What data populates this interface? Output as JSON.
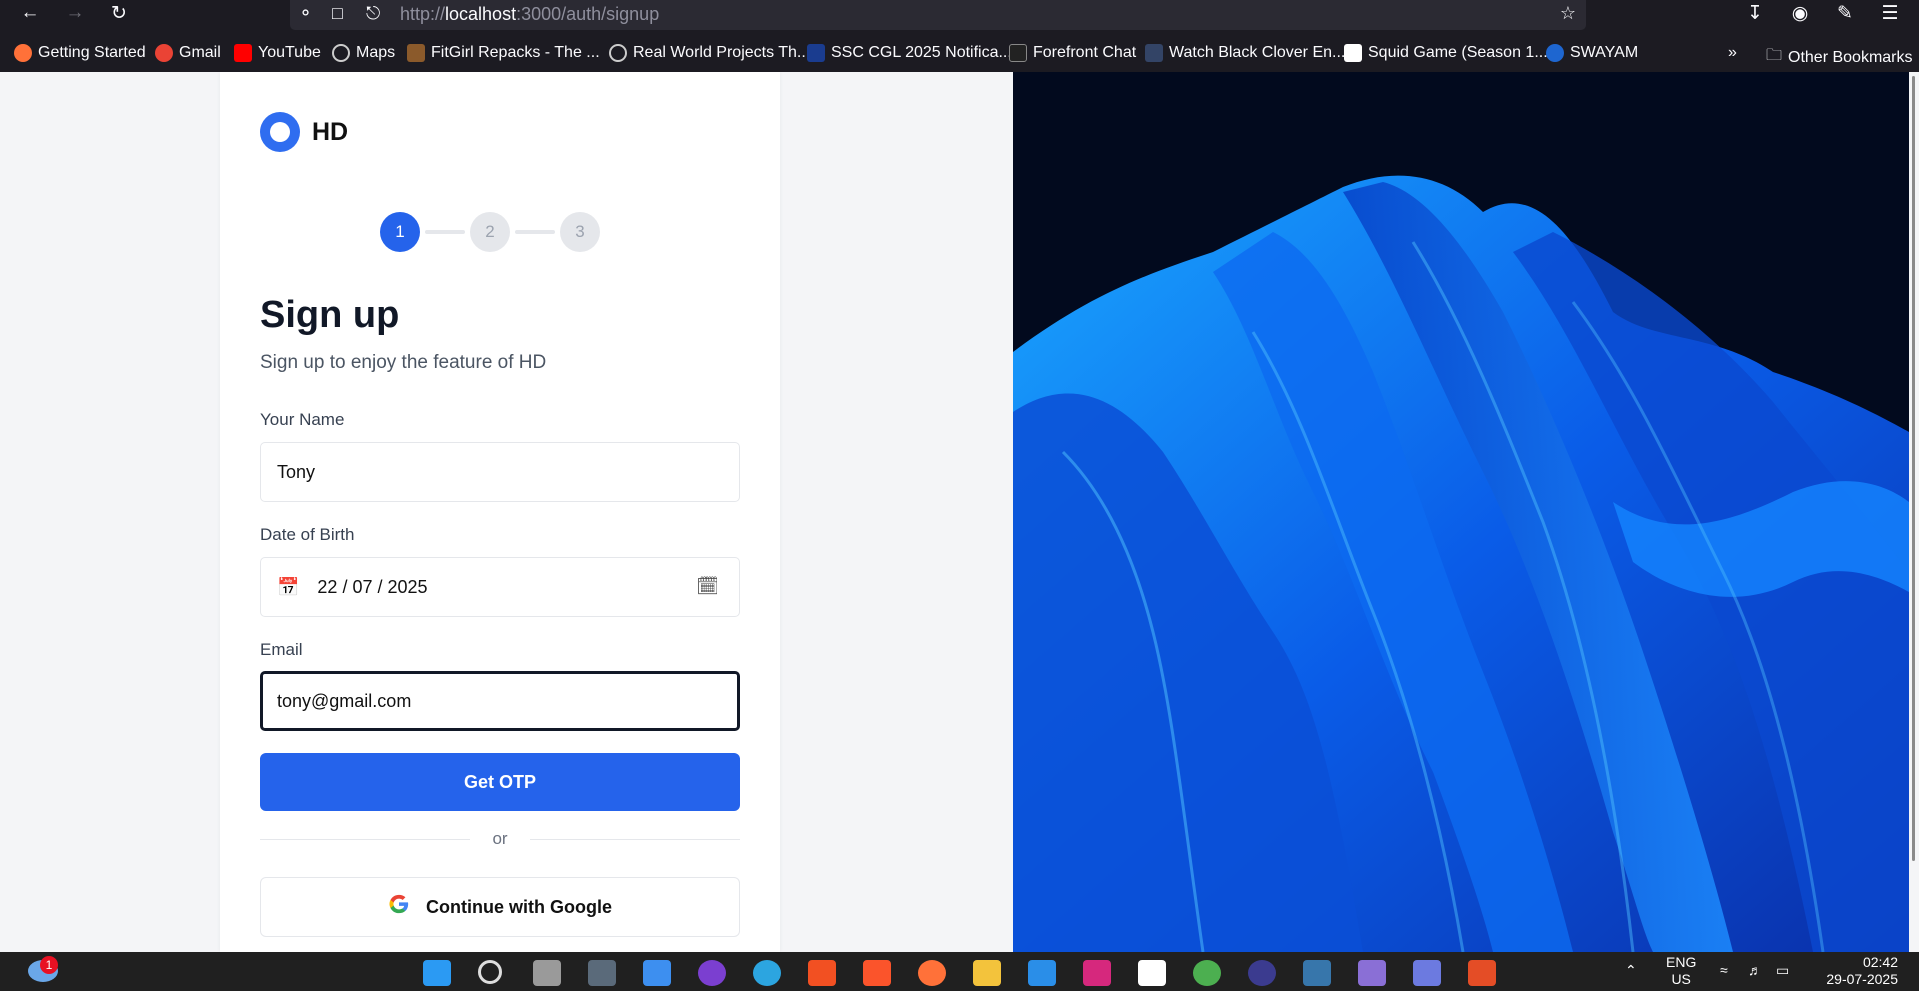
{
  "browser": {
    "url_prefix": "http://",
    "url_host": "localhost",
    "url_path": ":3000/auth/signup",
    "bookmarks": [
      {
        "label": "Getting Started",
        "color": "#ff7139"
      },
      {
        "label": "Gmail",
        "color": "#ea4335"
      },
      {
        "label": "YouTube",
        "color": "#ff0000"
      },
      {
        "label": "Maps",
        "color": "#cccccc"
      },
      {
        "label": "FitGirl Repacks - The ...",
        "color": "#8b5a2b"
      },
      {
        "label": "Real World Projects Th...",
        "color": "#cccccc"
      },
      {
        "label": "SSC CGL 2025 Notifica...",
        "color": "#1a3c8f"
      },
      {
        "label": "Forefront Chat",
        "color": "#222222"
      },
      {
        "label": "Watch Black Clover En...",
        "color": "#334466"
      },
      {
        "label": "Squid Game (Season 1...",
        "color": "#ffffff"
      },
      {
        "label": "SWAYAM",
        "color": "#1e66d0"
      }
    ],
    "other_bookmarks": "Other Bookmarks"
  },
  "app": {
    "logo_text": "HD",
    "steps": [
      "1",
      "2",
      "3"
    ],
    "title": "Sign up",
    "subtitle": "Sign up to enjoy the feature of HD",
    "name_label": "Your Name",
    "name_value": "Tony",
    "dob_label": "Date of Birth",
    "dob_value": "22 / 07 / 2025",
    "email_label": "Email",
    "email_value": "tony@gmail.com",
    "otp_button": "Get OTP",
    "divider": "or",
    "google_button": "Continue with Google",
    "accent_color": "#2563eb"
  },
  "taskbar": {
    "weather_badge": "1",
    "lang_line1": "ENG",
    "lang_line2": "US",
    "time": "02:42",
    "date": "29-07-2025"
  }
}
